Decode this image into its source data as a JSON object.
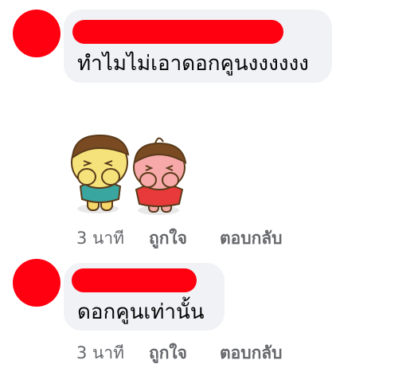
{
  "colors": {
    "avatar_red": "#ff0010",
    "bubble_bg": "#f0f2f5",
    "text": "#050505",
    "meta_text": "#65676b"
  },
  "comments": [
    {
      "author": "",
      "text": "ทำไมไม่เอาดอกคูนงงงงงง",
      "time": "3 นาที",
      "like_label": "ถูกใจ",
      "reply_label": "ตอบกลับ",
      "has_sticker": true,
      "sticker_name": "two-kids-covering-faces-sticker"
    },
    {
      "author": "",
      "text": "ดอกคูนเท่านั้น",
      "time": "3 นาที",
      "like_label": "ถูกใจ",
      "reply_label": "ตอบกลับ",
      "has_sticker": false
    }
  ]
}
